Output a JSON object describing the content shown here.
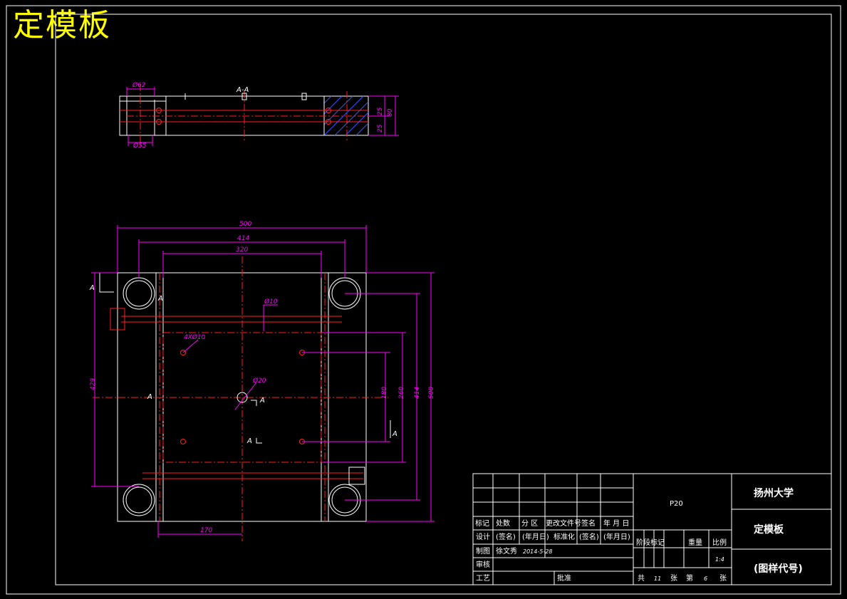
{
  "title": "定模板",
  "section_label": "A-A",
  "dimensions": {
    "phi62": "Ø62",
    "phi55": "Ø55",
    "d25a": "25",
    "d25b": "25",
    "d80": "80",
    "d500_top": "500",
    "d414_top": "414",
    "d320": "320",
    "phi10": "Ø10",
    "four_phi10": "4XØ10",
    "phi20": "Ø20",
    "d429": "429",
    "d180": "180",
    "d260": "260",
    "d414_right": "414",
    "d500_right": "500",
    "d170": "170"
  },
  "section_marks": {
    "a1": "A",
    "a2": "A",
    "a3": "A",
    "a4": "A",
    "a5": "A",
    "a6": "A"
  },
  "title_block": {
    "material": "P20",
    "school": "扬州大学",
    "part_name": "定模板",
    "drawing_code": "(图样代号)",
    "row_headers": [
      "标记",
      "处数",
      "分 区",
      "更改文件号",
      "签名",
      "年 月 日"
    ],
    "design_row": [
      "设计",
      "(签名)",
      "(年月日)",
      "标准化",
      "(签名)",
      "(年月日)"
    ],
    "draw_label": "制图",
    "drawer": "徐文秀",
    "date": "2014-5-28",
    "check_label": "审核",
    "process_label": "工艺",
    "approve_label": "批准",
    "stage_mark": "阶段标记",
    "weight": "重量",
    "scale_label": "比例",
    "scale_value": "1:4",
    "total_label": "共",
    "total_sheets": "11",
    "sheet_label": "张",
    "page_label": "第",
    "page_no": "6",
    "page_suffix": "张"
  }
}
